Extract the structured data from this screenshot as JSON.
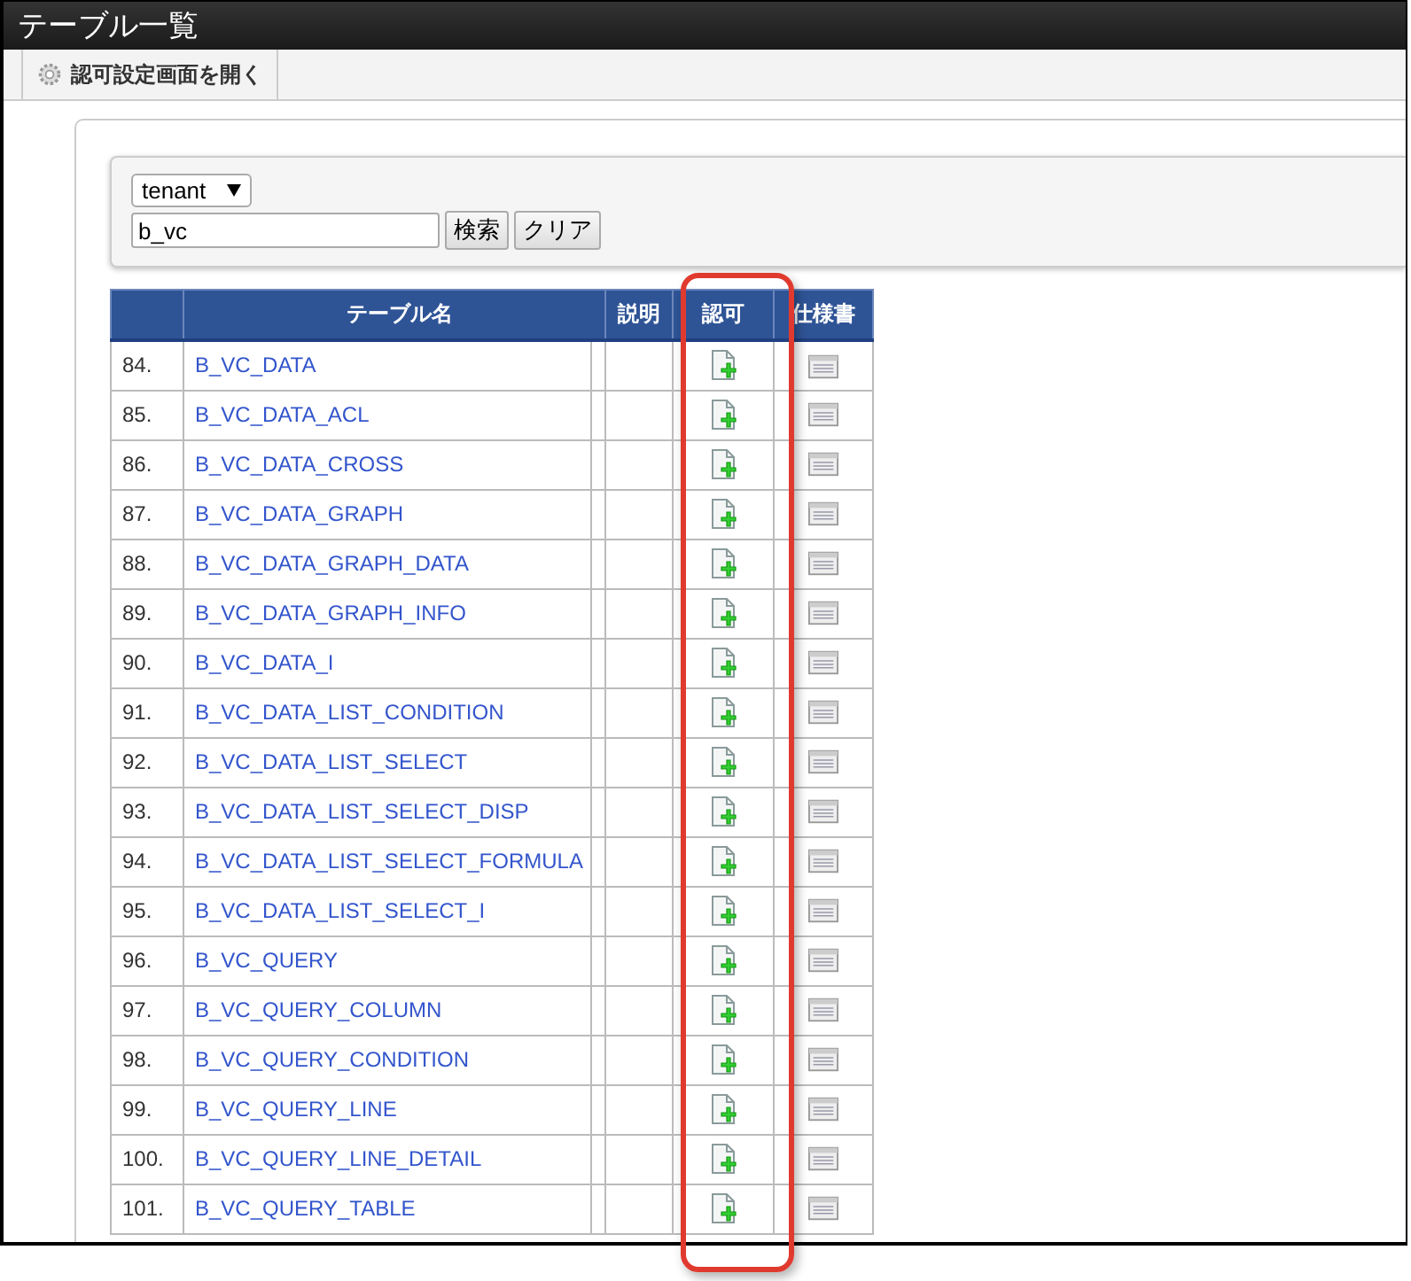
{
  "window": {
    "title": "テーブル一覧"
  },
  "toolbar": {
    "button": "認可設定画面を開く"
  },
  "search": {
    "select": "tenant",
    "value": "b_vc",
    "buttons": [
      "検索",
      "クリア"
    ]
  },
  "table": {
    "columns": [
      "テーブル名",
      "説明",
      "認可",
      "仕様書"
    ],
    "rows": [
      {
        "no": "84.",
        "name": "B_VC_DATA"
      },
      {
        "no": "85.",
        "name": "B_VC_DATA_ACL"
      },
      {
        "no": "86.",
        "name": "B_VC_DATA_CROSS"
      },
      {
        "no": "87.",
        "name": "B_VC_DATA_GRAPH"
      },
      {
        "no": "88.",
        "name": "B_VC_DATA_GRAPH_DATA"
      },
      {
        "no": "89.",
        "name": "B_VC_DATA_GRAPH_INFO"
      },
      {
        "no": "90.",
        "name": "B_VC_DATA_I"
      },
      {
        "no": "91.",
        "name": "B_VC_DATA_LIST_CONDITION"
      },
      {
        "no": "92.",
        "name": "B_VC_DATA_LIST_SELECT"
      },
      {
        "no": "93.",
        "name": "B_VC_DATA_LIST_SELECT_DISP"
      },
      {
        "no": "94.",
        "name": "B_VC_DATA_LIST_SELECT_FORMULA"
      },
      {
        "no": "95.",
        "name": "B_VC_DATA_LIST_SELECT_I"
      },
      {
        "no": "96.",
        "name": "B_VC_QUERY"
      },
      {
        "no": "97.",
        "name": "B_VC_QUERY_COLUMN"
      },
      {
        "no": "98.",
        "name": "B_VC_QUERY_CONDITION"
      },
      {
        "no": "99.",
        "name": "B_VC_QUERY_LINE"
      },
      {
        "no": "100.",
        "name": "B_VC_QUERY_LINE_DETAIL"
      },
      {
        "no": "101.",
        "name": "B_VC_QUERY_TABLE"
      }
    ]
  }
}
